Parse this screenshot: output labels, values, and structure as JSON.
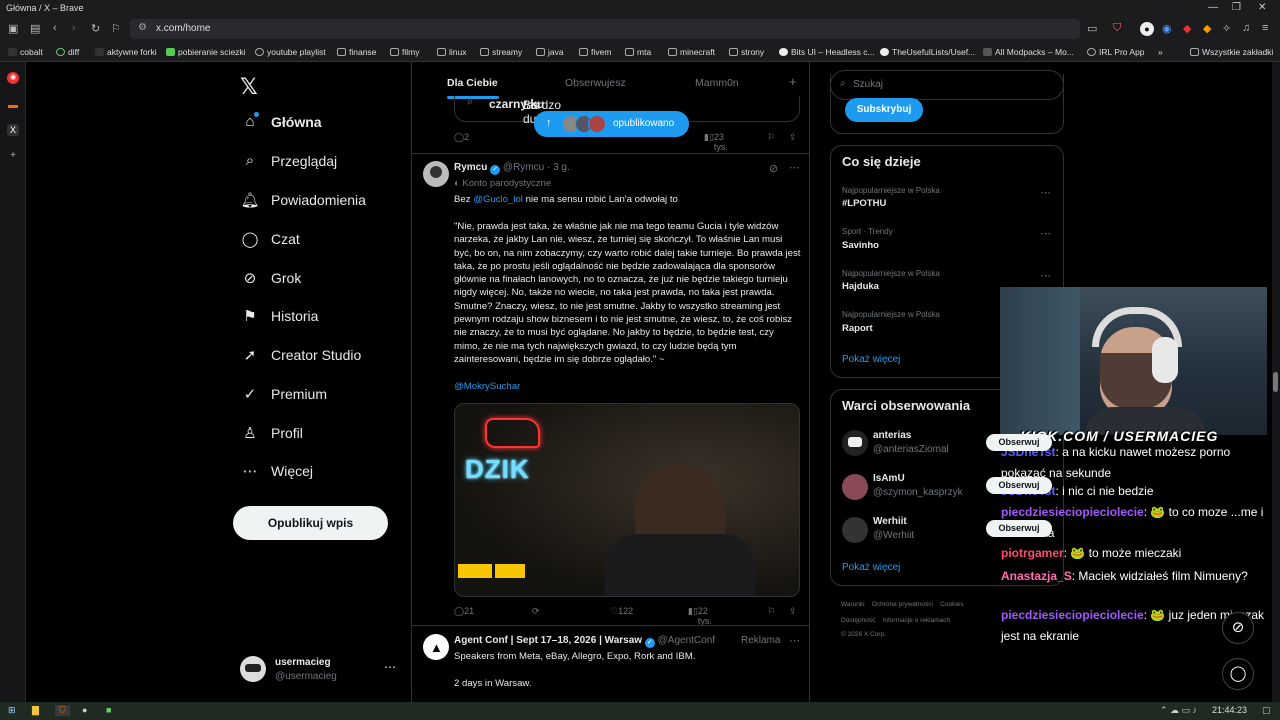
{
  "window": {
    "title": "Główna / X – Brave"
  },
  "browser": {
    "url": "x.com/home"
  },
  "bookmarks": [
    "cobalt",
    "diff",
    "aktywne forki",
    "pobieranie sciezki",
    "youtube playlist",
    "finanse",
    "filmy",
    "linux",
    "streamy",
    "java",
    "fivem",
    "mta",
    "minecraft",
    "strony",
    "Bits UI – Headless c...",
    "TheUsefulLists/Usef...",
    "All Modpacks – Mo...",
    "IRL Pro App",
    "»",
    "Wszystkie zakładki"
  ],
  "nav": {
    "items": [
      {
        "icon": "⌂",
        "label": "Główna"
      },
      {
        "icon": "⌕",
        "label": "Przeglądaj"
      },
      {
        "icon": "🔔︎",
        "label": "Powiadomienia"
      },
      {
        "icon": "◯",
        "label": "Czat"
      },
      {
        "icon": "⊘",
        "label": "Grok"
      },
      {
        "icon": "⚑",
        "label": "Historia"
      },
      {
        "icon": "➚",
        "label": "Creator Studio"
      },
      {
        "icon": "✓",
        "label": "Premium"
      },
      {
        "icon": "♙",
        "label": "Profil"
      },
      {
        "icon": "⋯",
        "label": "Więcej"
      }
    ],
    "post_button": "Opublikuj wpis"
  },
  "account": {
    "name": "usermacieg",
    "handle": "@usermacieg"
  },
  "tabs": [
    "Dla Ciebie",
    "Obserwujesz",
    "Mamm0n",
    "+"
  ],
  "prev_post": {
    "text_pre": "Bardzo duży ",
    "text_bold": "czarny ku",
    "text_post": "tas",
    "pill_label": "opublikowano",
    "replies": "2",
    "views": "23 tys."
  },
  "tweet": {
    "name": "Rymcu",
    "handle": "@Rymcu · 3 g.",
    "badge": "Konto parodystyczne",
    "line1_pre": "Bez ",
    "line1_mention": "@Guclo_lol",
    "line1_post": " nie ma sensu robić Lan'a odwołaj to",
    "quote": "\"Nie, prawda jest taka, że właśnie jak nie ma tego teamu Gucia i tyle widzów narzeka, że jakby Lan nie, wiesz, że turniej się skończył. To właśnie Lan musi być, bo on, na nim zobaczymy, czy warto robić dalej takie turnieje. Bo prawda jest taka, że po prostu jeśli oglądalność nie będzie zadowalająca dla sponsorów głównie na finałach lanowych, no to oznacza, że już nie będzie takiego turnieju nigdy więcej. No, także no wiecie, no taka jest prawda, no taka jest prawda. Smutne? Znaczy, wiesz, to nie jest smutne. Jakby to wszystko streaming jest pewnym rodzaju show biznesem i to nie jest smutne, że wiesz, to, że coś robisz nie znaczy, że to musi być oglądane. No jakby to będzie, to będzie test, czy mimo, że nie ma tych największych gwiazd, to czy ludzie będą tym zainteresowani, będzie im się dobrze oglądało.\" ~",
    "quote_author": "@MokrySuchar",
    "media_sign": "DZIK",
    "replies": "21",
    "likes": "122",
    "views": "22 tys."
  },
  "ad": {
    "name": "Agent Conf | Sept 17–18, 2026 | Warsaw",
    "handle": "@AgentConf",
    "ad_label": "Reklama",
    "text1": "Speakers from Meta, eBay, Allegro, Expo, Rork and IBM.",
    "text2": "2 days in Warsaw."
  },
  "search": {
    "placeholder": "Szukaj"
  },
  "subscribe": "Subskrybuj",
  "trends": {
    "title": "Co się dzieje",
    "items": [
      {
        "cat": "Najpopularniejsze w Polska",
        "name": "#LPOTHU"
      },
      {
        "cat": "Sport · Trendy",
        "name": "Savinho"
      },
      {
        "cat": "Najpopularniejsze w Polska",
        "name": "Hajduka"
      },
      {
        "cat": "Najpopularniejsze w Polska",
        "name": "Raport"
      }
    ],
    "more": "Pokaż więcej"
  },
  "follow": {
    "title": "Warci obserwowania",
    "button": "Obserwuj",
    "items": [
      {
        "name": "anterias",
        "handle": "@anteriasZiomal"
      },
      {
        "name": "IsAmU",
        "handle": "@szymon_kasprzyk"
      },
      {
        "name": "Werhiit",
        "handle": "@Werhiit"
      }
    ],
    "more": "Pokaż więcej"
  },
  "footer": {
    "l1a": "Warunki",
    "l1b": "Ochrona prywatności",
    "l1c": "Cookies",
    "l2a": "Dostępność",
    "l2b": "Informacje o reklamach",
    "l3": "© 2026 X Corp."
  },
  "stream": {
    "kick": "KICK.COM / USERMACIEG",
    "chat": [
      {
        "user": "JSDheTst",
        "color": "#5f5cff",
        "msg": "a na kicku nawet możesz porno pokazać na sekunde"
      },
      {
        "user": "JSDheTst",
        "color": "#5f5cff",
        "msg": "i nic ci nie bedzie"
      },
      {
        "user": "piecdziesieciopieciolecie",
        "color": "#a259ff",
        "msg": "🐸 to co moze ...me i wódeczka"
      },
      {
        "user": "piotrgamer",
        "color": "#ff4b6e",
        "msg": "🐸 to może mieczaki"
      },
      {
        "user": "Anastazja_S",
        "color": "#ff6fb0",
        "msg": "Maciek widziałeś film Nimueny?"
      },
      {
        "user": "piecdziesieciopieciolecie",
        "color": "#a259ff",
        "msg": "🐸 juz jeden mieczak jest na ekranie"
      }
    ]
  },
  "taskbar": {
    "time": "21:44:23"
  },
  "colors": {
    "accent": "#1d9bf0",
    "bg": "#000000",
    "border": "#2f3336",
    "muted": "#71767b"
  }
}
